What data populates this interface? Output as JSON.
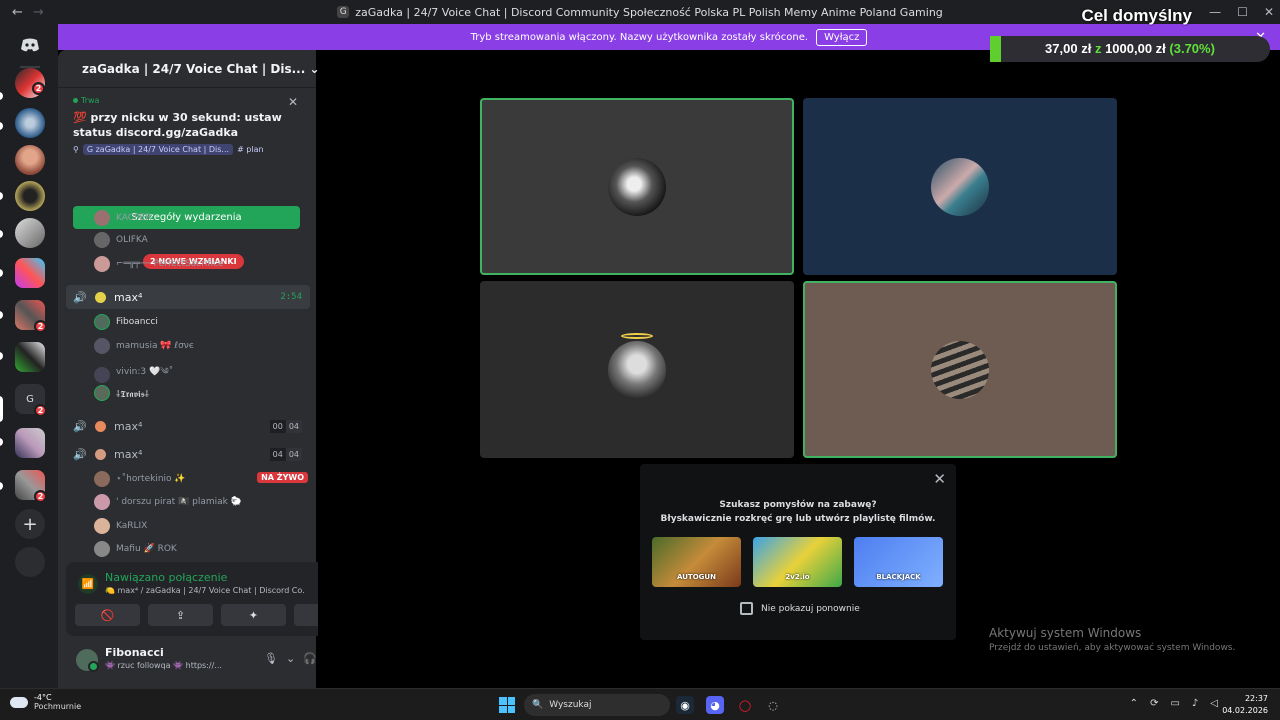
{
  "window": {
    "title": "zaGadka | 24/7 Voice Chat | Discord Community Społeczność Polska PL Polish Memy Anime Poland Gaming",
    "back_icon": "←",
    "forward_icon": "→",
    "tab_icon": "G",
    "minimize": "—",
    "maximize": "☐",
    "close": "✕"
  },
  "stream_goal": {
    "title": "Cel domyślny",
    "current": "37,00 zł",
    "separator": "z",
    "target": "1000,00 zł",
    "percent_text": "(3.70%)",
    "progress": 0.037
  },
  "banner": {
    "text": "Tryb streamowania włączony. Nazwy użytkownika zostały skrócone.",
    "button": "Wyłącz",
    "close": "✕"
  },
  "rail": {
    "badges": [
      "2",
      "2",
      "2",
      "2"
    ]
  },
  "server": {
    "name": "zaGadka | 24/7 Voice Chat | Dis...",
    "chevron": "⌄",
    "add_user_icon": "👤+"
  },
  "event": {
    "status": "Trwa",
    "title": "💯 przy nicku w 30 sekund: ustaw status discord.gg/zaGadka",
    "location_server": "G zaGadka | 24/7 Voice Chat | Dis...",
    "location_channel": "# plan",
    "button": "Szczegóły wydarzenia",
    "close": "✕"
  },
  "mention_pill": "2 NOWE WZMIANKI",
  "voice_users_top": [
    {
      "name": "KACPER"
    },
    {
      "name": "OLIFKA"
    },
    {
      "name": "⌐═╦╤── PerfectSacrifice"
    }
  ],
  "channels": [
    {
      "name": "max⁴",
      "time": "2:54",
      "active": true
    },
    {
      "name": "max⁴",
      "counter": [
        "00",
        "04"
      ]
    },
    {
      "name": "max⁴",
      "counter": [
        "04",
        "04"
      ]
    }
  ],
  "channel1_users": [
    {
      "name": "Fiboancci"
    },
    {
      "name": "mamusia 🎀 ℓσνє"
    },
    {
      "name": "vivin:3 🤍༄˚"
    },
    {
      "name": "⸸𝕿𝖗𝖆𝖛𝖎𝖘⸸"
    }
  ],
  "channel3_users": [
    {
      "name": "⋆˚hortekinio ✨"
    },
    {
      "name": "' dorszu pirat 🏴‍☠️ plamiak 🐑"
    },
    {
      "name": "KaRLIX"
    },
    {
      "name": "Mafiu 🚀 ROK"
    }
  ],
  "live_label": "NA ŻYWO",
  "voice": {
    "status": "Nawiązano połączenie",
    "channel": "🍋 max⁴ / zaGadka | 24/7 Voice Chat | Discord Co...",
    "signal_icon": "📶",
    "noise_icon": "⫽",
    "disconnect_icon": "☎"
  },
  "voice_buttons": [
    "🚫",
    "⇪",
    "✦",
    "✺"
  ],
  "user": {
    "name": "Fibonacci",
    "status": "👾 rzuc followqa 👾 https://...",
    "mic_icon": "🎙",
    "headset_icon": "🎧",
    "settings_icon": "⚙"
  },
  "suggest": {
    "line1": "Szukasz pomysłów na zabawę?",
    "line2": "Błyskawicznie rozkręć grę lub utwórz playlistę filmów.",
    "games": [
      "AUTOGUN",
      "2v2.io",
      "BLACKJACK"
    ],
    "checkbox_label": "Nie pokazuj ponownie",
    "close": "✕"
  },
  "watermark": {
    "line1": "Aktywuj system Windows",
    "line2": "Przejdź do ustawień, aby aktywować system Windows."
  },
  "taskbar": {
    "temp": "-4°C",
    "weather": "Pochmurnie",
    "search": "Wyszukaj",
    "time": "22:37",
    "date": "04.02.2026",
    "search_icon": "🔍"
  }
}
